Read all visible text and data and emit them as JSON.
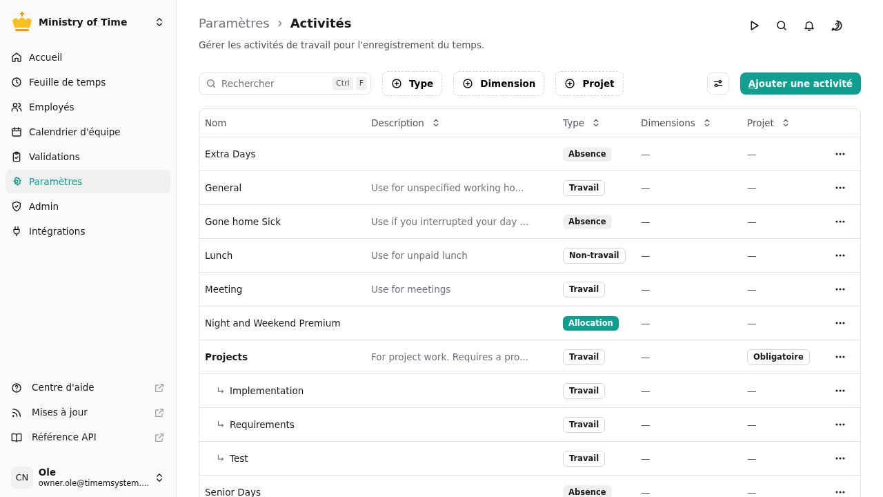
{
  "org": {
    "name": "Ministry of Time"
  },
  "nav": [
    {
      "label": "Accueil",
      "selected": false
    },
    {
      "label": "Feuille de temps",
      "selected": false
    },
    {
      "label": "Employés",
      "selected": false
    },
    {
      "label": "Calendrier d'équipe",
      "selected": false
    },
    {
      "label": "Validations",
      "selected": false
    },
    {
      "label": "Paramètres",
      "selected": true
    },
    {
      "label": "Admin",
      "selected": false
    },
    {
      "label": "Intégrations",
      "selected": false
    }
  ],
  "footer_links": [
    {
      "label": "Centre d'aide"
    },
    {
      "label": "Mises à jour"
    },
    {
      "label": "Référence API"
    }
  ],
  "user": {
    "initials": "CN",
    "name": "Ole",
    "email": "owner.ole@timemsystem...."
  },
  "breadcrumb": {
    "parent": "Paramètres",
    "current": "Activités"
  },
  "subtitle": "Gérer les activités de travail pour l'enregistrement du temps.",
  "search": {
    "placeholder": "Rechercher",
    "keys": [
      "Ctrl",
      "F"
    ]
  },
  "filters": [
    "Type",
    "Dimension",
    "Projet"
  ],
  "add_button": "Ajouter une activité",
  "table": {
    "columns": [
      {
        "label": "Nom",
        "sortable": false
      },
      {
        "label": "Description",
        "sortable": true
      },
      {
        "label": "Type",
        "sortable": true
      },
      {
        "label": "Dimensions",
        "sortable": true
      },
      {
        "label": "Projet",
        "sortable": true
      }
    ],
    "rows": [
      {
        "name": "Extra Days",
        "type": {
          "label": "Absence",
          "kind": "absence"
        },
        "dimensions": "—",
        "project": {
          "label": "—",
          "kind": "none"
        }
      },
      {
        "name": "General",
        "description": "Use for unspecified working ho...",
        "type": {
          "label": "Travail",
          "kind": "work"
        },
        "dimensions": "—",
        "project": {
          "label": "—",
          "kind": "none"
        }
      },
      {
        "name": "Gone home Sick",
        "description": "Use if you interrupted your day ...",
        "type": {
          "label": "Absence",
          "kind": "absence"
        },
        "dimensions": "—",
        "project": {
          "label": "—",
          "kind": "none"
        }
      },
      {
        "name": "Lunch",
        "description": "Use for unpaid lunch",
        "type": {
          "label": "Non-travail",
          "kind": "work"
        },
        "dimensions": "—",
        "project": {
          "label": "—",
          "kind": "none"
        }
      },
      {
        "name": "Meeting",
        "description": "Use for meetings",
        "type": {
          "label": "Travail",
          "kind": "work"
        },
        "dimensions": "—",
        "project": {
          "label": "—",
          "kind": "none"
        }
      },
      {
        "name": "Night and Weekend Premium",
        "type": {
          "label": "Allocation",
          "kind": "allocation"
        },
        "dimensions": "—",
        "project": {
          "label": "—",
          "kind": "none"
        }
      },
      {
        "name": "Projects",
        "description": "For project work. Requires a pro...",
        "type": {
          "label": "Travail",
          "kind": "work"
        },
        "dimensions": "—",
        "project": {
          "label": "Obligatoire",
          "kind": "badge"
        },
        "children": [
          {
            "name": "Implementation",
            "type": {
              "label": "Travail",
              "kind": "work"
            },
            "dimensions": "—",
            "project": {
              "label": "—",
              "kind": "none"
            }
          },
          {
            "name": "Requirements",
            "type": {
              "label": "Travail",
              "kind": "work"
            },
            "dimensions": "—",
            "project": {
              "label": "—",
              "kind": "none"
            }
          },
          {
            "name": "Test",
            "type": {
              "label": "Travail",
              "kind": "work"
            },
            "dimensions": "—",
            "project": {
              "label": "—",
              "kind": "none"
            }
          }
        ]
      },
      {
        "name": "Senior Days",
        "type": {
          "label": "Absence",
          "kind": "absence"
        },
        "dimensions": "—",
        "project": {
          "label": "—",
          "kind": "none"
        }
      }
    ]
  }
}
